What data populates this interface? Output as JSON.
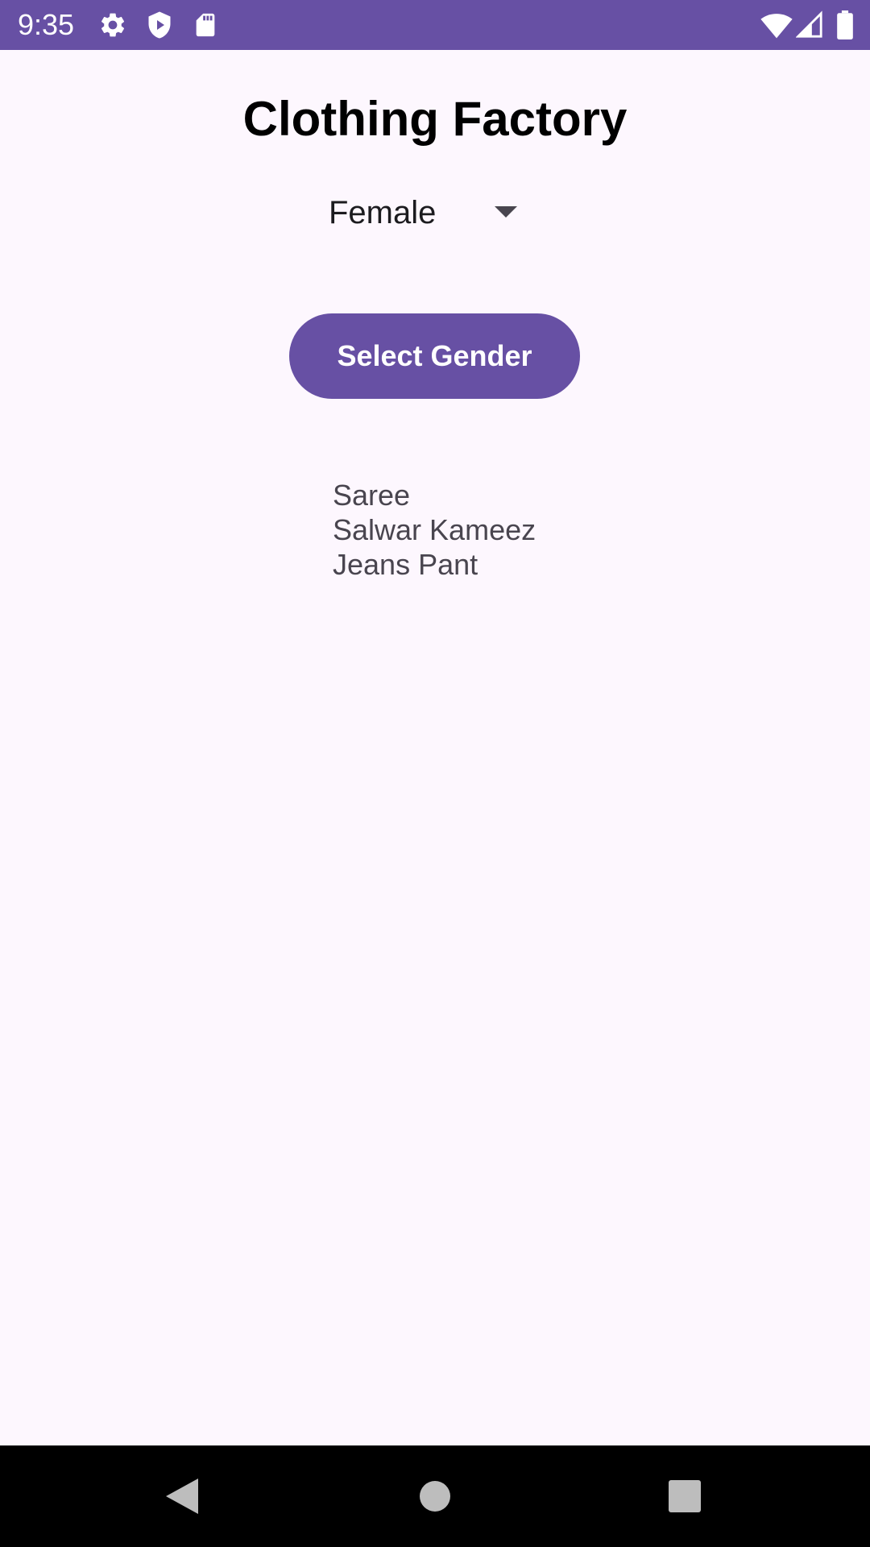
{
  "status_bar": {
    "time": "9:35",
    "icons": [
      "gear-icon",
      "shield-icon",
      "sd-card-icon",
      "wifi-icon",
      "signal-icon",
      "battery-icon"
    ],
    "background": "#6750A4"
  },
  "main": {
    "title": "Clothing Factory",
    "spinner": {
      "selected": "Female"
    },
    "select_button_label": "Select Gender",
    "items": [
      "Saree",
      "Salwar Kameez",
      "Jeans Pant"
    ]
  },
  "nav_bar": {
    "buttons": [
      "back-icon",
      "home-icon",
      "recents-icon"
    ]
  },
  "colors": {
    "accent": "#6750A4",
    "background": "#FDF7FE",
    "list_text": "#49454F"
  }
}
